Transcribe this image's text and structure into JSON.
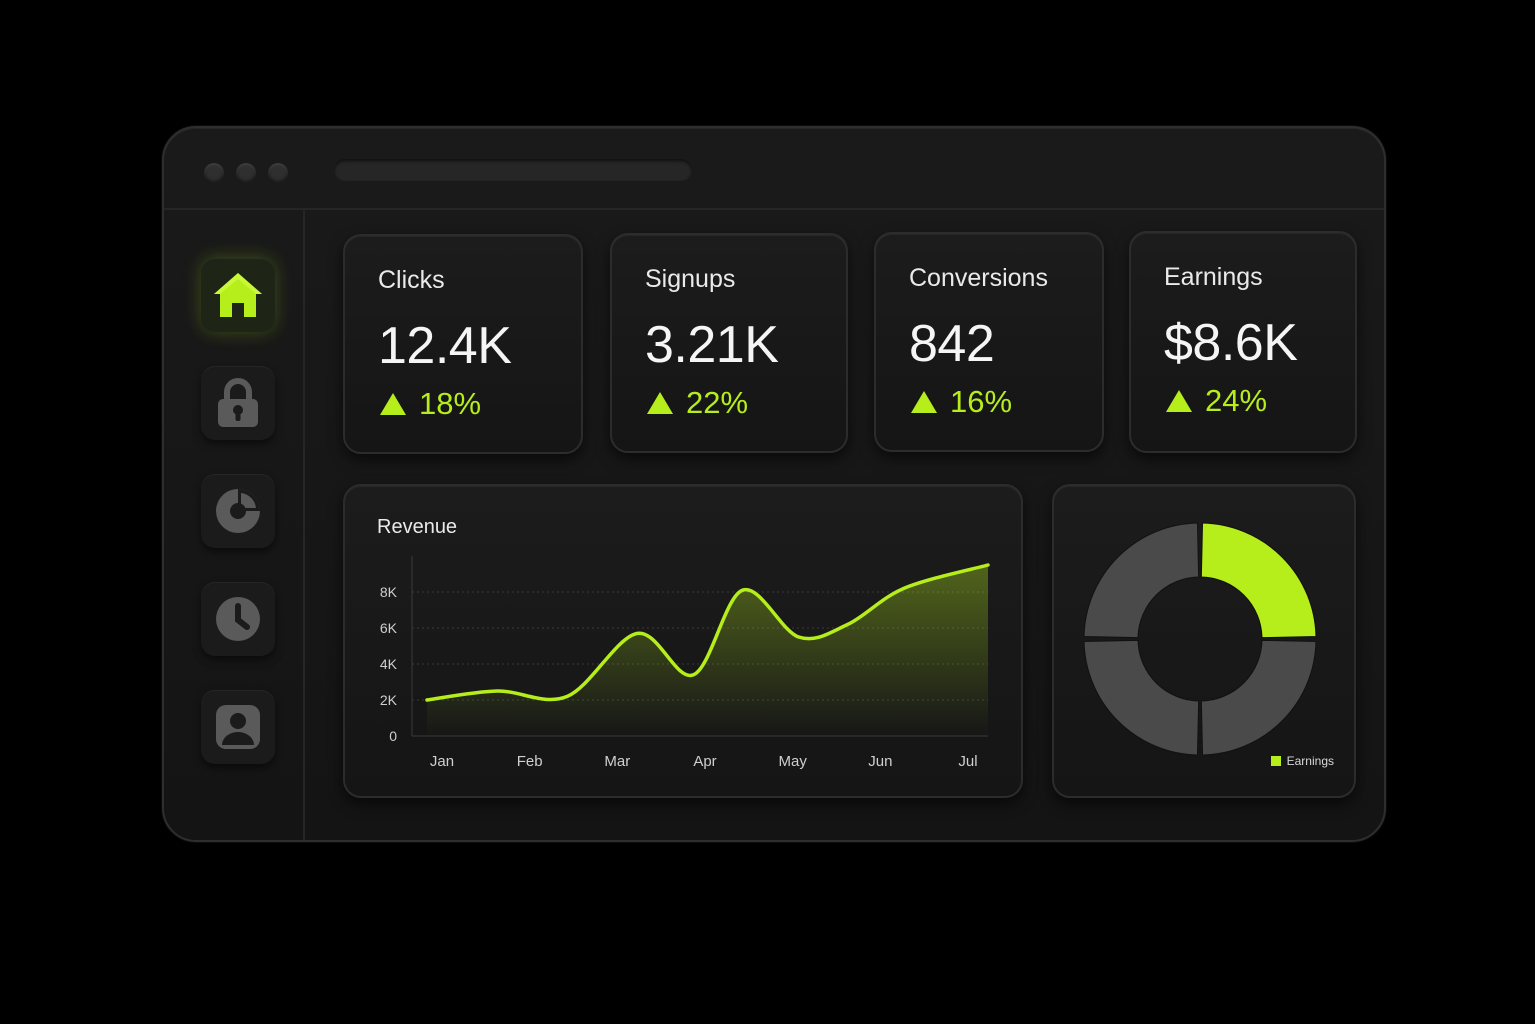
{
  "colors": {
    "accent": "#b6ee1c",
    "background": "#000000",
    "panel": "#161616",
    "segment_dark": "#4a4a4a"
  },
  "window": {
    "controls": [
      "window-dot",
      "window-dot",
      "window-dot"
    ]
  },
  "sidebar": {
    "items": [
      {
        "icon": "home-icon",
        "active": true
      },
      {
        "icon": "lock-icon",
        "active": false
      },
      {
        "icon": "pie-chart-icon",
        "active": false
      },
      {
        "icon": "clock-icon",
        "active": false
      },
      {
        "icon": "user-icon",
        "active": false
      }
    ]
  },
  "stats": [
    {
      "title": "Clicks",
      "value": "12.4K",
      "change": "18%"
    },
    {
      "title": "Signups",
      "value": "3.21K",
      "change": "22%"
    },
    {
      "title": "Conversions",
      "value": "842",
      "change": "16%"
    },
    {
      "title": "Earnings",
      "value": "$8.6K",
      "change": "24%"
    }
  ],
  "chart_data": [
    {
      "type": "area",
      "title": "Revenue",
      "categories": [
        "Jan",
        "Feb",
        "Mar",
        "Apr",
        "May",
        "Jun",
        "Jul"
      ],
      "x": [
        0,
        1,
        2,
        3,
        3.8,
        4.5,
        5.3,
        6,
        6.8,
        8
      ],
      "series": [
        {
          "values": [
            2000,
            2500,
            2200,
            5700,
            3400,
            8100,
            5500,
            6200,
            8200,
            9500
          ]
        }
      ],
      "yticks": [
        "0",
        "2K",
        "4K",
        "6K",
        "8K"
      ],
      "ytick_values": [
        0,
        2000,
        4000,
        6000,
        8000
      ],
      "ylim": [
        0,
        10000
      ],
      "grid": true
    },
    {
      "type": "pie",
      "style": "donut",
      "legend": "Earnings",
      "legend_position": "bottom-right",
      "slices": [
        {
          "value": 25,
          "highlight": true
        },
        {
          "value": 25,
          "highlight": false
        },
        {
          "value": 25,
          "highlight": false
        },
        {
          "value": 25,
          "highlight": false
        }
      ]
    }
  ]
}
